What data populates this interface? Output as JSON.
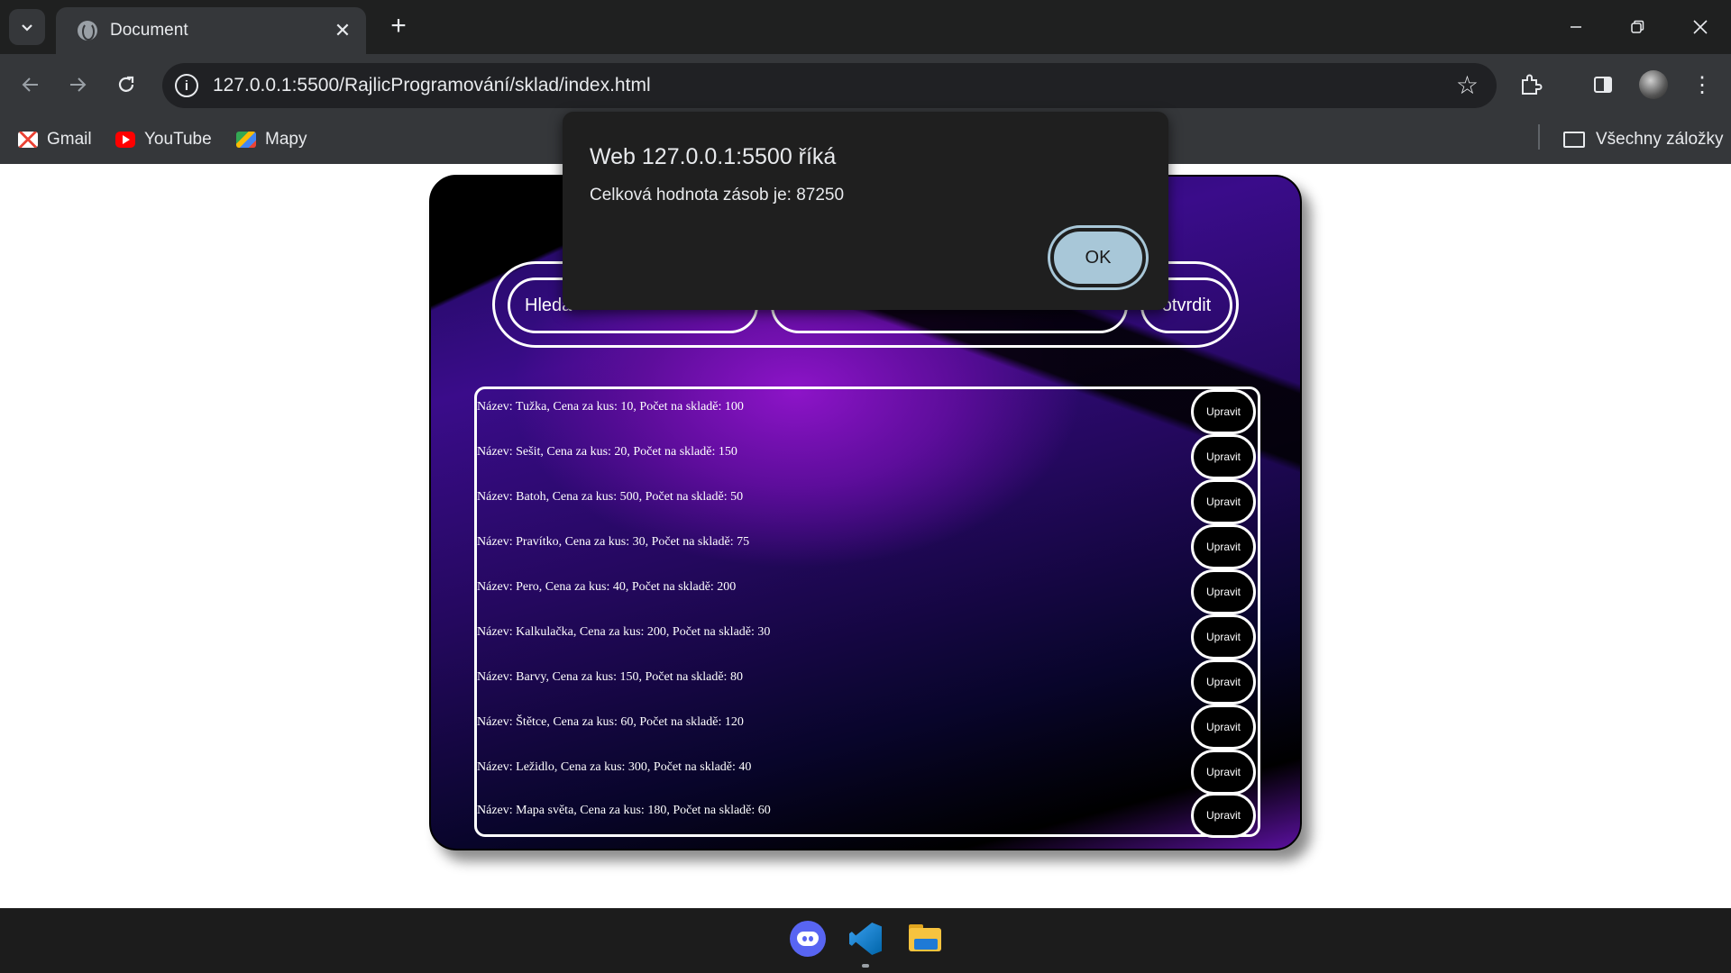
{
  "browser": {
    "tab_title": "Document",
    "url": "127.0.0.1:5500/RajlicProgramování/sklad/index.html",
    "bookmarks": [
      "Gmail",
      "YouTube",
      "Mapy"
    ],
    "all_bookmarks": "Všechny záložky"
  },
  "app": {
    "search_label": "Hleda",
    "middle_label": "",
    "confirm_label": "otvrdit",
    "edit_label": "Upravit",
    "items": [
      "Název: Tužka, Cena za kus: 10, Počet na skladě: 100",
      "Název: Sešit, Cena za kus: 20, Počet na skladě: 150",
      "Název: Batoh, Cena za kus: 500, Počet na skladě: 50",
      "Název: Pravítko, Cena za kus: 30, Počet na skladě: 75",
      "Název: Pero, Cena za kus: 40, Počet na skladě: 200",
      "Název: Kalkulačka, Cena za kus: 200, Počet na skladě: 30",
      "Název: Barvy, Cena za kus: 150, Počet na skladě: 80",
      "Název: Štětce, Cena za kus: 60, Počet na skladě: 120",
      "Název: Ležidlo, Cena za kus: 300, Počet na skladě: 40",
      "Název: Mapa světa, Cena za kus: 180, Počet na skladě: 60"
    ]
  },
  "dialog": {
    "title": "Web 127.0.0.1:5500 říká",
    "message": "Celková hodnota zásob je: 87250",
    "ok_label": "OK"
  },
  "taskbar": {
    "apps": [
      "discord-icon",
      "vscode-icon",
      "file-explorer-icon"
    ]
  }
}
